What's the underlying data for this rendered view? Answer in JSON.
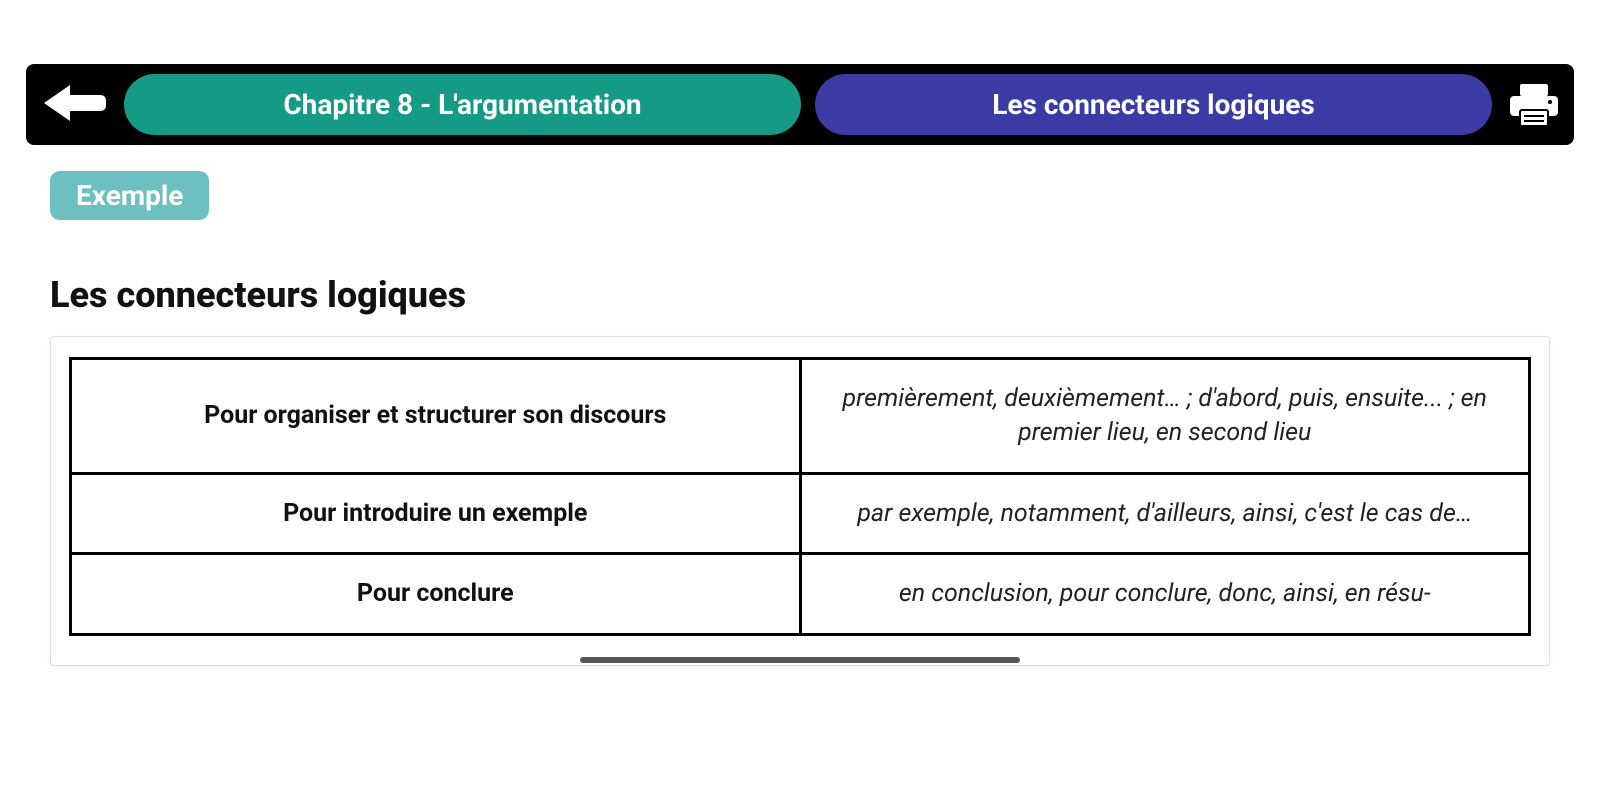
{
  "header": {
    "chapter_label": "Chapitre 8 - L'argumentation",
    "topic_label": "Les connecteurs logiques"
  },
  "body": {
    "tag_label": "Exemple",
    "heading": "Les connecteurs logiques",
    "table": {
      "rows": [
        {
          "label": "Pour organiser et structurer son discours",
          "values": "premièrement, deuxièmement… ; d'abord, puis, ensuite... ; en premier lieu, en second lieu"
        },
        {
          "label": "Pour introduire un exemple",
          "values": "par exemple, notamment, d'ailleurs, ainsi, c'est le cas de…"
        },
        {
          "label": "Pour conclure",
          "values": "en conclusion, pour conclure, donc, ainsi, en résu-"
        }
      ]
    }
  },
  "colors": {
    "teal": "#159a86",
    "indigo": "#3b3ba5",
    "tag": "#6cc1c0"
  }
}
